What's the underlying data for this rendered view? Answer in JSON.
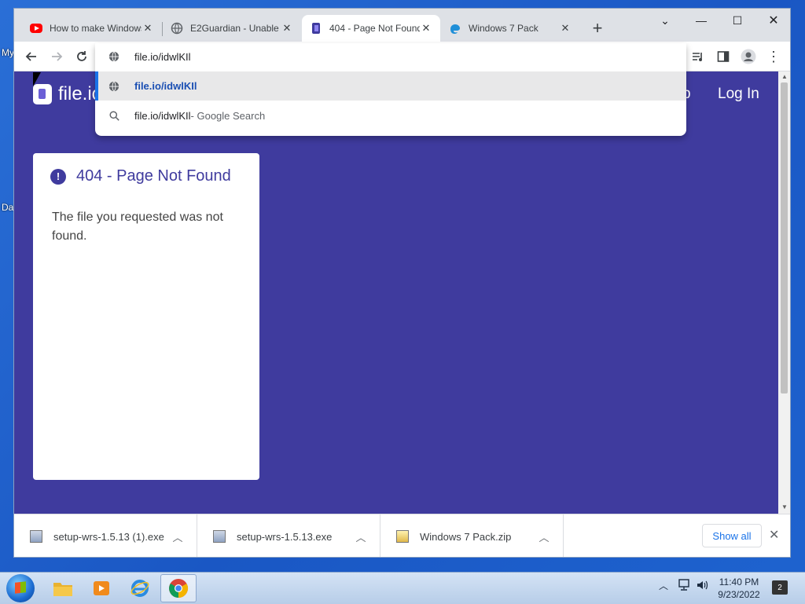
{
  "desktop": {
    "frag1": "My",
    "frag2": "Da"
  },
  "tabs": [
    {
      "title": "How to make Windows",
      "icon": "youtube-icon",
      "active": false
    },
    {
      "title": "E2Guardian - Unable",
      "icon": "globe-icon",
      "active": false
    },
    {
      "title": "404 - Page Not Found",
      "icon": "fileio-icon",
      "active": true
    },
    {
      "title": "Windows 7 Pack",
      "icon": "edge-icon",
      "active": false
    }
  ],
  "omnibox": {
    "value": "file.io/idwlKIl",
    "suggestions": [
      {
        "text": "file.io/idwlKIl",
        "suffix": "",
        "icon": "globe-icon",
        "selected": true
      },
      {
        "text": "file.io/idwlKIl",
        "suffix": " - Google Search",
        "icon": "search-icon",
        "selected": false
      }
    ]
  },
  "page": {
    "logo_text": "file.io",
    "nav_fragment": "p",
    "login": "Log In",
    "card_title": "404 - Page Not Found",
    "card_message": "The file you requested was not found."
  },
  "downloads": {
    "items": [
      {
        "name": "setup-wrs-1.5.13 (1).exe"
      },
      {
        "name": "setup-wrs-1.5.13.exe"
      },
      {
        "name": "Windows 7 Pack.zip"
      }
    ],
    "show_all": "Show all"
  },
  "taskbar": {
    "time": "11:40 PM",
    "date": "9/23/2022",
    "notification_count": "2"
  },
  "colors": {
    "page_bg": "#3f3b9e",
    "accent": "#1a73e8"
  }
}
